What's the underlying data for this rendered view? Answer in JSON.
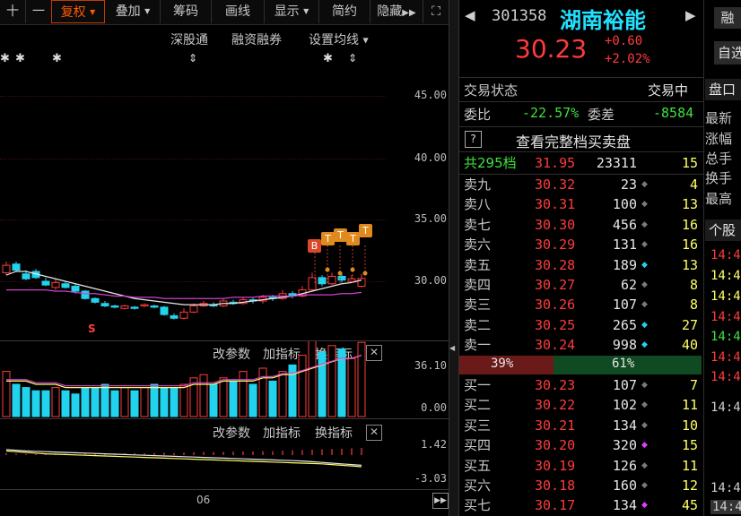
{
  "toolbar": {
    "plus": "十",
    "minus": "一",
    "fuquan": "复权",
    "diejia": "叠加",
    "chouma": "筹码",
    "huaxian": "画线",
    "xianshi": "显示",
    "jianyue": "简约",
    "yincang": "隐藏",
    "expand": "⛶"
  },
  "chart_menu": {
    "shengutong": "深股通",
    "rongzi": "融资融券",
    "junxian": "设置均线"
  },
  "axis": {
    "main": [
      "45.00",
      "40.00",
      "35.00",
      "30.00"
    ],
    "vol": [
      "36.10",
      "0.00"
    ],
    "macd": [
      "1.42",
      "-3.03"
    ],
    "date": "06"
  },
  "sub_menu": {
    "gaicanshu": "改参数",
    "jiazhibiao": "加指标",
    "huanzhibiao": "换指标",
    "close": "✕"
  },
  "markers": {
    "b": "B",
    "t": "T",
    "s": "S"
  },
  "header": {
    "code": "301358",
    "name": "湖南裕能",
    "price": "30.23",
    "change": "+0.60",
    "change_pct": "+2.02%",
    "arrow_left": "◀",
    "arrow_right": "▶"
  },
  "status": {
    "label": "交易状态",
    "value": "交易中"
  },
  "weibi": {
    "label": "委比",
    "value": "-22.57%",
    "label2": "委差",
    "value2": "-8584"
  },
  "full_book": {
    "help": "?",
    "text": "查看完整档买卖盘"
  },
  "summary": {
    "label": "共295档",
    "price": "31.95",
    "vol": "23311",
    "n": "15"
  },
  "asks": [
    {
      "name": "卖九",
      "price": "30.32",
      "vol": "23",
      "mark": "◆",
      "mcolor": "#7a7a7a",
      "n": "4"
    },
    {
      "name": "卖八",
      "price": "30.31",
      "vol": "100",
      "mark": "◆",
      "mcolor": "#7a7a7a",
      "n": "13"
    },
    {
      "name": "卖七",
      "price": "30.30",
      "vol": "456",
      "mark": "◆",
      "mcolor": "#7a7a7a",
      "n": "16"
    },
    {
      "name": "卖六",
      "price": "30.29",
      "vol": "131",
      "mark": "◆",
      "mcolor": "#7a7a7a",
      "n": "16"
    },
    {
      "name": "卖五",
      "price": "30.28",
      "vol": "189",
      "mark": "◆",
      "mcolor": "#22d3ee",
      "n": "13"
    },
    {
      "name": "卖四",
      "price": "30.27",
      "vol": "62",
      "mark": "◆",
      "mcolor": "#7a7a7a",
      "n": "8"
    },
    {
      "name": "卖三",
      "price": "30.26",
      "vol": "107",
      "mark": "◆",
      "mcolor": "#7a7a7a",
      "n": "8"
    },
    {
      "name": "卖二",
      "price": "30.25",
      "vol": "265",
      "mark": "◆",
      "mcolor": "#22d3ee",
      "n": "27"
    },
    {
      "name": "卖一",
      "price": "30.24",
      "vol": "998",
      "mark": "◆",
      "mcolor": "#22d3ee",
      "n": "40"
    }
  ],
  "ratio": {
    "sell": "39%",
    "buy": "61%",
    "sell_frac": 0.39
  },
  "bids": [
    {
      "name": "买一",
      "price": "30.23",
      "vol": "107",
      "mark": "◆",
      "mcolor": "#7a7a7a",
      "n": "7"
    },
    {
      "name": "买二",
      "price": "30.22",
      "vol": "102",
      "mark": "◆",
      "mcolor": "#7a7a7a",
      "n": "11"
    },
    {
      "name": "买三",
      "price": "30.21",
      "vol": "134",
      "mark": "◆",
      "mcolor": "#7a7a7a",
      "n": "10"
    },
    {
      "name": "买四",
      "price": "30.20",
      "vol": "320",
      "mark": "◆",
      "mcolor": "#e040fb",
      "n": "15"
    },
    {
      "name": "买五",
      "price": "30.19",
      "vol": "126",
      "mark": "◆",
      "mcolor": "#7a7a7a",
      "n": "11"
    },
    {
      "name": "买六",
      "price": "30.18",
      "vol": "160",
      "mark": "◆",
      "mcolor": "#7a7a7a",
      "n": "12"
    },
    {
      "name": "买七",
      "price": "30.17",
      "vol": "134",
      "mark": "◆",
      "mcolor": "#e040fb",
      "n": "45"
    }
  ],
  "far_right": {
    "btn_rong": "融",
    "btn_zi": "自选",
    "tab": "盘口",
    "labels": [
      "最新",
      "涨幅",
      "总手",
      "换手",
      "最高"
    ],
    "tab2": "个股",
    "times": [
      "14:4",
      "14:4",
      "14:4",
      "14:4",
      "14:4",
      "14:4",
      "14:4",
      "14:4",
      "14:4",
      "14:4"
    ]
  },
  "colors": {
    "up": "#ff3b3b",
    "down": "#22d3ee",
    "accent": "#ff5a00",
    "name": "#22e0ff",
    "green": "#3fe13f",
    "yellow": "#ffff66"
  },
  "candles": [
    {
      "o": 30.7,
      "c": 31.3,
      "h": 31.6,
      "l": 30.5
    },
    {
      "o": 31.4,
      "c": 30.9,
      "h": 31.6,
      "l": 30.8
    },
    {
      "o": 30.6,
      "c": 30.2,
      "h": 30.9,
      "l": 30.1
    },
    {
      "o": 30.8,
      "c": 30.3,
      "h": 31.0,
      "l": 30.2
    },
    {
      "o": 30.0,
      "c": 29.7,
      "h": 30.3,
      "l": 29.6
    },
    {
      "o": 29.5,
      "c": 29.9,
      "h": 30.2,
      "l": 29.3
    },
    {
      "o": 29.8,
      "c": 29.5,
      "h": 30.0,
      "l": 29.4
    },
    {
      "o": 29.6,
      "c": 29.2,
      "h": 29.8,
      "l": 29.0
    },
    {
      "o": 29.2,
      "c": 28.6,
      "h": 29.3,
      "l": 28.5
    },
    {
      "o": 28.6,
      "c": 28.3,
      "h": 28.7,
      "l": 28.2
    },
    {
      "o": 28.2,
      "c": 28.0,
      "h": 28.4,
      "l": 27.9
    },
    {
      "o": 28.0,
      "c": 27.9,
      "h": 28.1,
      "l": 27.8
    },
    {
      "o": 27.8,
      "c": 28.0,
      "h": 28.1,
      "l": 27.7
    },
    {
      "o": 27.9,
      "c": 27.8,
      "h": 28.0,
      "l": 27.7
    },
    {
      "o": 28.0,
      "c": 28.1,
      "h": 28.2,
      "l": 27.9
    },
    {
      "o": 28.0,
      "c": 27.9,
      "h": 28.1,
      "l": 27.8
    },
    {
      "o": 27.9,
      "c": 27.3,
      "h": 28.0,
      "l": 27.2
    },
    {
      "o": 27.2,
      "c": 27.0,
      "h": 27.4,
      "l": 26.9
    },
    {
      "o": 27.0,
      "c": 27.5,
      "h": 27.8,
      "l": 26.9
    },
    {
      "o": 27.5,
      "c": 28.0,
      "h": 28.2,
      "l": 27.4
    },
    {
      "o": 28.0,
      "c": 28.2,
      "h": 28.4,
      "l": 27.9
    },
    {
      "o": 28.1,
      "c": 28.0,
      "h": 28.3,
      "l": 27.9
    },
    {
      "o": 28.0,
      "c": 28.4,
      "h": 28.6,
      "l": 27.9
    },
    {
      "o": 28.3,
      "c": 28.2,
      "h": 28.5,
      "l": 28.1
    },
    {
      "o": 28.2,
      "c": 28.5,
      "h": 28.7,
      "l": 28.1
    },
    {
      "o": 28.5,
      "c": 28.4,
      "h": 28.7,
      "l": 28.2
    },
    {
      "o": 28.4,
      "c": 28.7,
      "h": 28.9,
      "l": 28.2
    },
    {
      "o": 28.7,
      "c": 28.6,
      "h": 28.9,
      "l": 28.4
    },
    {
      "o": 28.6,
      "c": 29.0,
      "h": 29.3,
      "l": 28.5
    },
    {
      "o": 29.0,
      "c": 28.8,
      "h": 29.2,
      "l": 28.6
    },
    {
      "o": 28.8,
      "c": 29.3,
      "h": 29.6,
      "l": 28.7
    },
    {
      "o": 29.3,
      "c": 30.3,
      "h": 30.7,
      "l": 29.2
    },
    {
      "o": 30.3,
      "c": 29.8,
      "h": 30.5,
      "l": 29.6
    },
    {
      "o": 29.8,
      "c": 30.4,
      "h": 30.7,
      "l": 29.7
    },
    {
      "o": 30.4,
      "c": 30.1,
      "h": 30.6,
      "l": 29.9
    },
    {
      "o": 30.0,
      "c": 30.2,
      "h": 30.5,
      "l": 29.9
    },
    {
      "o": 29.6,
      "c": 30.23,
      "h": 30.6,
      "l": 29.5
    }
  ],
  "ma": [
    30.5,
    30.8,
    30.8,
    30.6,
    30.4,
    30.2,
    30.0,
    29.8,
    29.6,
    29.4,
    29.2,
    29.0,
    28.8,
    28.6,
    28.5,
    28.4,
    28.3,
    28.2,
    28.1,
    28.1,
    28.1,
    28.1,
    28.2,
    28.2,
    28.3,
    28.4,
    28.5,
    28.6,
    28.7,
    28.8,
    29.0,
    29.2,
    29.4,
    29.6,
    29.8,
    29.9,
    30.1
  ],
  "ma2": [
    29.3,
    29.3,
    29.3,
    29.3,
    29.3,
    29.2,
    29.2,
    29.1,
    29.0,
    29.0,
    28.9,
    28.8,
    28.8,
    28.7,
    28.7,
    28.7,
    28.6,
    28.6,
    28.6,
    28.6,
    28.6,
    28.6,
    28.6,
    28.7,
    28.7,
    28.7,
    28.8,
    28.8,
    28.8,
    28.8,
    28.9,
    28.9,
    28.9,
    28.9,
    29.0,
    29.0,
    29.1
  ],
  "volumes": [
    14,
    10,
    9,
    8,
    8,
    9,
    8,
    7,
    9,
    9,
    10,
    8,
    9,
    8,
    9,
    10,
    9,
    9,
    10,
    12,
    13,
    10,
    12,
    11,
    14,
    10,
    15,
    11,
    14,
    16,
    19,
    24,
    20,
    22,
    21,
    18,
    23
  ],
  "vol_ma": [
    11,
    11,
    11,
    10,
    10,
    10,
    9,
    9,
    9,
    9,
    9,
    9,
    9,
    9,
    9,
    9,
    9,
    9,
    9,
    10,
    10,
    10,
    11,
    11,
    11,
    11,
    12,
    12,
    13,
    13,
    14,
    15,
    16,
    17,
    18,
    18,
    19
  ],
  "macd": [
    0.3,
    0.2,
    0.15,
    0.15,
    0.12,
    0.15,
    0.18,
    0.15,
    0.2,
    0.22,
    0.25,
    0.22,
    0.25,
    0.28,
    0.25,
    0.3,
    0.35,
    0.3,
    0.35,
    0.4,
    0.45,
    0.42,
    0.45,
    0.48,
    0.5,
    0.5,
    0.55,
    0.55,
    0.6,
    0.65,
    0.7,
    0.75,
    0.8,
    0.85,
    0.9,
    0.95,
    1.0
  ],
  "macd_line1": [
    -2.2,
    -2.1,
    -2.0,
    -1.9,
    -1.8,
    -1.75,
    -1.7,
    -1.65,
    -1.6,
    -1.55,
    -1.5,
    -1.45,
    -1.4,
    -1.35,
    -1.3,
    -1.25,
    -1.2,
    -1.15,
    -1.1,
    -1.05,
    -1.0,
    -0.95,
    -0.9,
    -0.85,
    -0.8,
    -0.75,
    -0.7,
    -0.65,
    -0.6,
    -0.55,
    -0.5,
    -0.45,
    -0.4,
    -0.3,
    -0.2,
    -0.1,
    0.0
  ],
  "macd_line2": [
    -2.4,
    -2.3,
    -2.2,
    -2.15,
    -2.1,
    -2.05,
    -2.0,
    -1.95,
    -1.9,
    -1.85,
    -1.8,
    -1.75,
    -1.7,
    -1.65,
    -1.6,
    -1.55,
    -1.5,
    -1.45,
    -1.4,
    -1.35,
    -1.3,
    -1.25,
    -1.2,
    -1.15,
    -1.1,
    -1.05,
    -1.0,
    -0.95,
    -0.9,
    -0.85,
    -0.8,
    -0.7,
    -0.6,
    -0.5,
    -0.4,
    -0.3,
    -0.2
  ]
}
